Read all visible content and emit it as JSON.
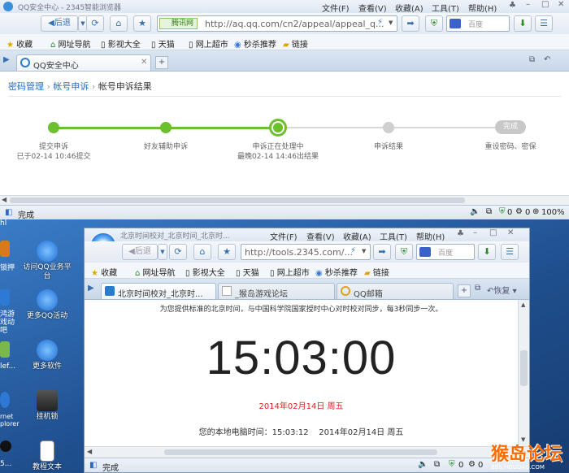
{
  "back_browser": {
    "window_title": "QQ安全中心 - 2345智能浏览器",
    "menu": [
      "文件(F)",
      "查看(V)",
      "收藏(A)",
      "工具(T)",
      "帮助(H)"
    ],
    "back_label": "后退",
    "site_badge": "腾讯网",
    "url": "http://aq.qq.com/cn2/appeal/appeal_q...",
    "search_placeholder": "百度",
    "favorites": [
      "收藏",
      "网址导航",
      "影视大全",
      "天猫",
      "网上超市",
      "秒杀推荐",
      "链接"
    ],
    "tab_title": "QQ安全中心",
    "breadcrumb": [
      "密码管理",
      "帐号申诉",
      "帐号申诉结果"
    ],
    "steps": [
      {
        "title": "提交申诉",
        "sub": "已于02-14  10:46提交",
        "state": "done"
      },
      {
        "title": "好友辅助申诉",
        "sub": "",
        "state": "done"
      },
      {
        "title": "申诉正在处理中",
        "sub": "最晚02-14  14:46出结果",
        "state": "current"
      },
      {
        "title": "申诉结果",
        "sub": "",
        "state": "pending"
      },
      {
        "title": "重设密码、密保",
        "sub": "",
        "state": "pending",
        "badge": "完成"
      }
    ],
    "status": "完成",
    "status_counts": [
      "0",
      "0"
    ],
    "zoom": "100%"
  },
  "desktop": {
    "icons": [
      {
        "label": "访问QQ业务平台"
      },
      {
        "label": "更多QQ活动"
      },
      {
        "label": "更多软件"
      },
      {
        "label": "挂机锁"
      },
      {
        "label": "教程文本"
      }
    ],
    "left_cut_labels": [
      "hl",
      "锁押",
      "鸿游戏动吧",
      "lef...",
      "rnet plorer",
      "QQ",
      "5..."
    ]
  },
  "front_browser": {
    "window_title": "北京时间校对_北京时间_北京时...",
    "menu": [
      "文件(F)",
      "查看(V)",
      "收藏(A)",
      "工具(T)",
      "帮助(H)"
    ],
    "back_label": "后退",
    "url": "http://tools.2345.com/...",
    "search_placeholder": "百度",
    "favorites": [
      "收藏",
      "网址导航",
      "影视大全",
      "天猫",
      "网上超市",
      "秒杀推荐",
      "链接"
    ],
    "tabs": [
      "北京时间校对_北京时...",
      "_猴岛游戏论坛",
      "QQ邮箱"
    ],
    "restore_label": "恢复",
    "intro": "为您提供标准的北京时间，与中国科学院国家授时中心对时校对同步，每3秒同步一次。",
    "clock": "15:03:00",
    "date": "2014年02月14日  周五",
    "local_label": "您的本地电脑时间：",
    "local_time": "15:03:12",
    "local_date": "2014年02月14日  周五",
    "status": "完成",
    "status_counts": [
      "0",
      "0"
    ]
  },
  "watermark": {
    "text": "猴岛论坛",
    "sub": "BBS.HOUDAO.COM"
  },
  "colors": {
    "step_done": "#6cbf2e",
    "step_pending": "#cccccc",
    "date_red": "#e02020"
  }
}
